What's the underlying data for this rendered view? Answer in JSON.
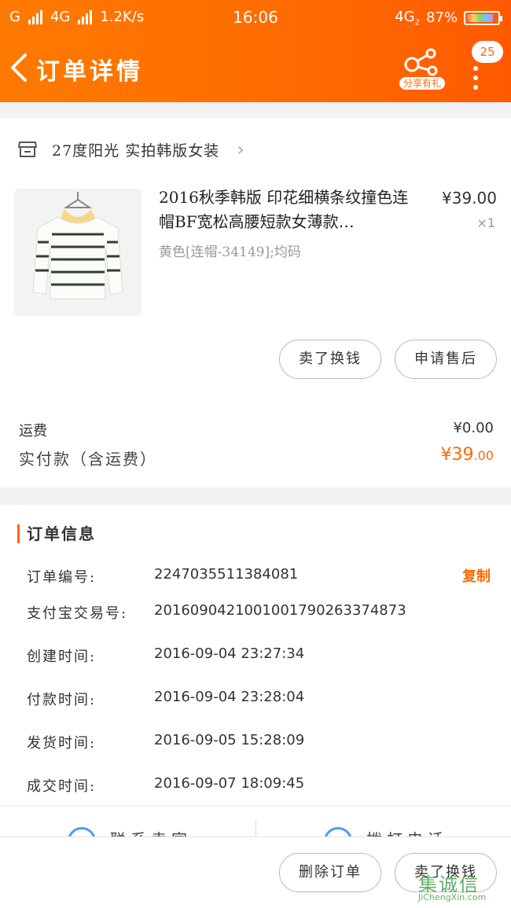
{
  "status_bar": {
    "carrier1": "G",
    "carrier2": "4G",
    "speed": "1.2K/s",
    "time": "16:06",
    "network": "4G",
    "network_sub": "2",
    "battery": "87%",
    "battery_level": 0.87
  },
  "header": {
    "title": "订单详情",
    "share_label": "分享有礼",
    "badge_count": "25"
  },
  "shop": {
    "name": "27度阳光 实拍韩版女装"
  },
  "product": {
    "title": "2016秋季韩版 印花细横条纹撞色连帽BF宽松高腰短款女薄款…",
    "sku": "黄色[连帽-34149];均码",
    "price": "¥39.00",
    "qty": "×1"
  },
  "item_actions": {
    "sell": "卖了换钱",
    "after_sale": "申请售后"
  },
  "summary": {
    "shipping_label": "运费",
    "shipping_value": "¥0.00",
    "paid_label": "实付款（含运费）",
    "paid_currency": "¥",
    "paid_int": "39",
    "paid_dec": ".00"
  },
  "order_info": {
    "heading": "订单信息",
    "copy_label": "复制",
    "rows": [
      {
        "k": "订单编号:",
        "v": "2247035511384081"
      },
      {
        "k": "支付宝交易号:",
        "v": "2016090421001001790263374873"
      },
      {
        "k": "创建时间:",
        "v": "2016-09-04 23:27:34"
      },
      {
        "k": "付款时间:",
        "v": "2016-09-04 23:28:04"
      },
      {
        "k": "发货时间:",
        "v": "2016-09-05 15:28:09"
      },
      {
        "k": "成交时间:",
        "v": "2016-09-07 18:09:45"
      }
    ]
  },
  "contact": {
    "seller": "联系卖家",
    "call": "拨打电话"
  },
  "bottom_actions": {
    "delete": "删除订单",
    "sell": "卖了换钱"
  },
  "watermark": {
    "cn": "集诚信",
    "en": "JiChengXin.com"
  },
  "colors": {
    "accent": "#ff6a00",
    "link_blue": "#4a9cf0"
  }
}
